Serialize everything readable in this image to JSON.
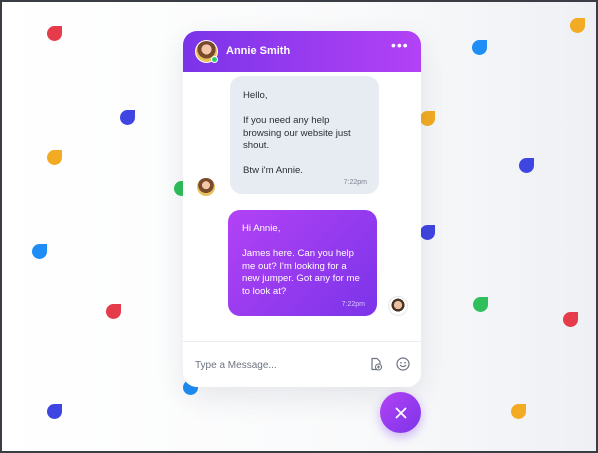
{
  "colors": {
    "accent_start": "#7b34e9",
    "accent_end": "#b342f5",
    "incoming_bubble": "#e6ecf1",
    "online": "#2ecc71",
    "confetti": [
      "#e53b4b",
      "#f2ab22",
      "#3f45e0",
      "#1e8df5",
      "#2fbf5b"
    ]
  },
  "chat": {
    "contact_name": "Annie Smith",
    "incoming": {
      "lines": [
        "Hello,",
        "If you need any help browsing our website just shout.",
        "Btw i'm Annie."
      ],
      "time": "7:22pm"
    },
    "outgoing": {
      "lines": [
        "Hi Annie,",
        "James here. Can you help me out? I'm looking for a new jumper. Got any for me to look at?"
      ],
      "time": "7:22pm"
    }
  },
  "composer": {
    "placeholder": "Type a Message..."
  },
  "icons": {
    "menu": "more-dots-icon",
    "attach": "attach-file-icon",
    "emoji": "emoji-icon",
    "close": "close-icon"
  }
}
